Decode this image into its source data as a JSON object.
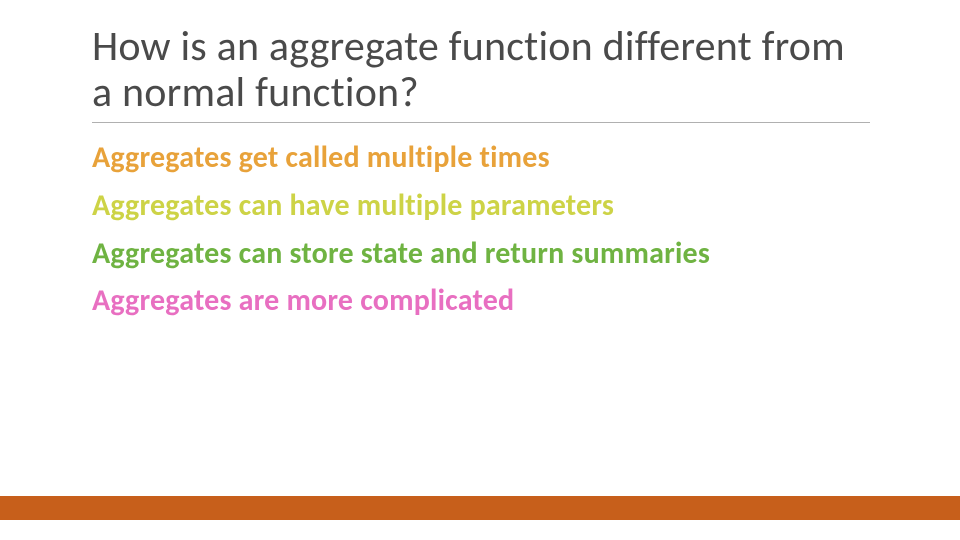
{
  "slide": {
    "title": "How is an aggregate function different from a normal function?",
    "points": [
      "Aggregates get called multiple times",
      "Aggregates can have multiple parameters",
      "Aggregates can store state and return summaries",
      "Aggregates are more complicated"
    ]
  },
  "colors": {
    "title": "#4a4a4a",
    "points": [
      "#e8a23a",
      "#cdd346",
      "#6fb342",
      "#e86fc1"
    ],
    "footer_bar": "#c75f1b"
  }
}
